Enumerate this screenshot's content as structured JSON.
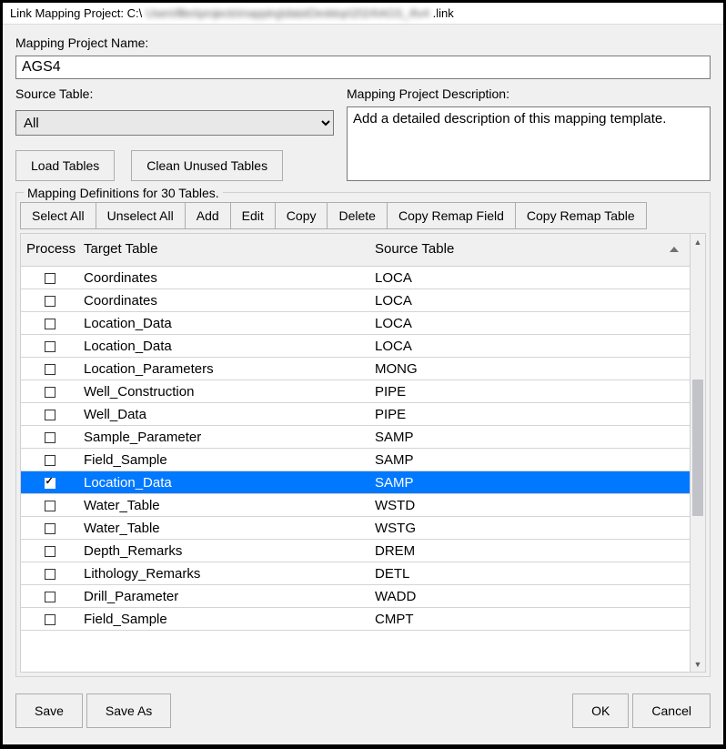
{
  "title_prefix": "Link Mapping Project: C:\\",
  "title_blur": "Users\\files\\projects\\mapping\\data\\Desktop\\2024\\AGS_4\\v4",
  "title_suffix": ".link",
  "proj_name_label": "Mapping Project Name:",
  "proj_name_value": "AGS4",
  "source_table_label": "Source Table:",
  "source_table_value": "All",
  "load_tables_btn": "Load Tables",
  "clean_unused_btn": "Clean Unused Tables",
  "desc_label": "Mapping Project Description:",
  "desc_value": "Add a detailed description of this mapping template.",
  "fieldset_legend": "Mapping Definitions for 30 Tables.",
  "toolbar": {
    "select_all": "Select All",
    "unselect_all": "Unselect All",
    "add": "Add",
    "edit": "Edit",
    "copy": "Copy",
    "delete": "Delete",
    "copy_remap_field": "Copy Remap Field",
    "copy_remap_table": "Copy Remap Table"
  },
  "columns": {
    "process": "Process",
    "target": "Target Table",
    "source": "Source Table"
  },
  "rows": [
    {
      "process": false,
      "target": "Coordinates",
      "source": "LOCA",
      "selected": false
    },
    {
      "process": false,
      "target": "Coordinates",
      "source": "LOCA",
      "selected": false
    },
    {
      "process": false,
      "target": "Location_Data",
      "source": "LOCA",
      "selected": false
    },
    {
      "process": false,
      "target": "Location_Data",
      "source": "LOCA",
      "selected": false
    },
    {
      "process": false,
      "target": "Location_Parameters",
      "source": "MONG",
      "selected": false
    },
    {
      "process": false,
      "target": "Well_Construction",
      "source": "PIPE",
      "selected": false
    },
    {
      "process": false,
      "target": "Well_Data",
      "source": "PIPE",
      "selected": false
    },
    {
      "process": false,
      "target": "Sample_Parameter",
      "source": "SAMP",
      "selected": false
    },
    {
      "process": false,
      "target": "Field_Sample",
      "source": "SAMP",
      "selected": false
    },
    {
      "process": true,
      "target": "Location_Data",
      "source": "SAMP",
      "selected": true
    },
    {
      "process": false,
      "target": "Water_Table",
      "source": "WSTD",
      "selected": false
    },
    {
      "process": false,
      "target": "Water_Table",
      "source": "WSTG",
      "selected": false
    },
    {
      "process": false,
      "target": "Depth_Remarks",
      "source": "DREM",
      "selected": false
    },
    {
      "process": false,
      "target": "Lithology_Remarks",
      "source": "DETL",
      "selected": false
    },
    {
      "process": false,
      "target": "Drill_Parameter",
      "source": "WADD",
      "selected": false
    },
    {
      "process": false,
      "target": "Field_Sample",
      "source": "CMPT",
      "selected": false
    }
  ],
  "footer": {
    "save": "Save",
    "save_as": "Save As",
    "ok": "OK",
    "cancel": "Cancel"
  }
}
